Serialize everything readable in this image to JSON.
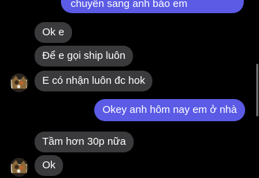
{
  "messages": [
    {
      "side": "out",
      "text": "chuyển sang anh báo em"
    },
    {
      "side": "in",
      "text": "Ok e"
    },
    {
      "side": "in",
      "text": "Để e gọi ship luôn"
    },
    {
      "side": "in",
      "text": "E có nhận luôn đc hok",
      "avatar": true
    },
    {
      "side": "out",
      "text": "Okey anh hôm nay em ở nhà"
    },
    {
      "side": "in",
      "text": "Tầm hơn 30p nữa"
    },
    {
      "side": "in",
      "text": "Ok",
      "avatar": true
    }
  ],
  "colors": {
    "background": "#000000",
    "incoming_bubble": "#3a3a3c",
    "outgoing_bubble": "#5b5be6",
    "text": "#ffffff"
  },
  "icons": {
    "avatar": "contact-avatar-icon"
  }
}
